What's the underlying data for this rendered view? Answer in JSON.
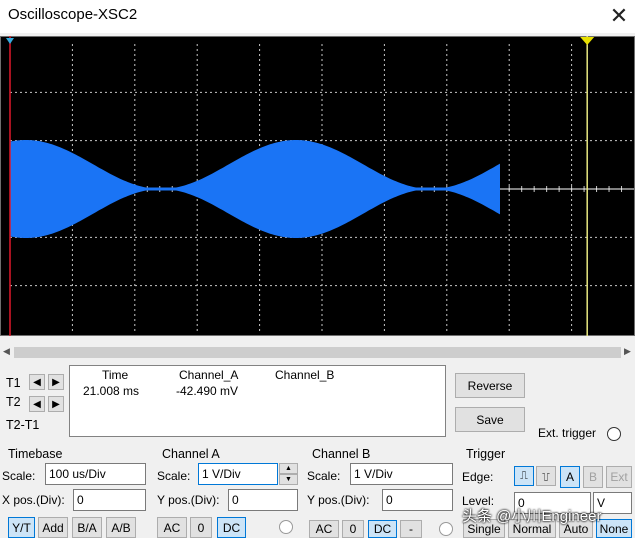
{
  "window": {
    "title": "Oscilloscope-XSC2",
    "close_glyph": "✕"
  },
  "colors": {
    "trace": "#1a74f5",
    "screen": "#000000",
    "cursor1": "#e0182a",
    "cursor2": "#e8e880",
    "grid": "#c8c8c8"
  },
  "cursors": {
    "t1_label": "T1",
    "t2_label": "T2",
    "diff_label": "T2-T1",
    "t1_pos": 0.0,
    "t2_pos": 0.925
  },
  "measurements": {
    "headers": [
      "Time",
      "Channel_A",
      "Channel_B"
    ],
    "rows": [
      [
        "21.008 ms",
        "-42.490 mV",
        ""
      ]
    ]
  },
  "buttons": {
    "reverse": "Reverse",
    "save": "Save",
    "ext_trigger": "Ext. trigger"
  },
  "timebase": {
    "title": "Timebase",
    "scale_label": "Scale:",
    "scale_value": "100 us/Div",
    "xpos_label": "X pos.(Div):",
    "xpos_value": "0",
    "modes": [
      "Y/T",
      "Add",
      "B/A",
      "A/B"
    ],
    "selected_mode": "Y/T"
  },
  "channel_a": {
    "title": "Channel A",
    "scale_label": "Scale:",
    "scale_value": "1  V/Div",
    "ypos_label": "Y pos.(Div):",
    "ypos_value": "0",
    "coupling": [
      "AC",
      "0",
      "DC"
    ],
    "selected": "DC"
  },
  "channel_b": {
    "title": "Channel B",
    "scale_label": "Scale:",
    "scale_value": "1  V/Div",
    "ypos_label": "Y pos.(Div):",
    "ypos_value": "0",
    "coupling": [
      "AC",
      "0",
      "DC",
      "-"
    ],
    "selected": "DC"
  },
  "trigger": {
    "title": "Trigger",
    "edge_label": "Edge:",
    "edge_rise": "⎍",
    "edge_fall": "⎍",
    "sources": [
      "A",
      "B",
      "Ext"
    ],
    "selected_source": "A",
    "level_label": "Level:",
    "level_value": "0",
    "level_unit": "V",
    "modes": [
      "Single",
      "Normal",
      "Auto",
      "None"
    ],
    "selected_mode": "None"
  },
  "watermark": "头条 @小川Engineer"
}
